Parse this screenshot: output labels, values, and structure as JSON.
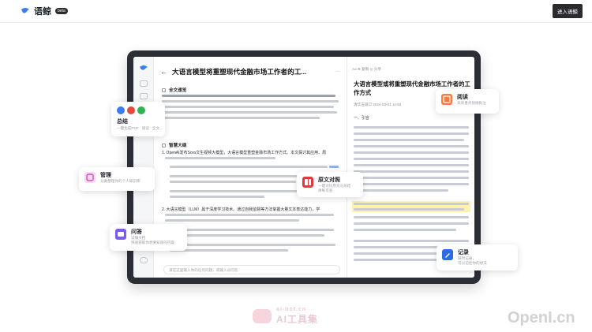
{
  "brand": {
    "name": "语鲸",
    "badge": "beta",
    "logo_color": "#3a7df0"
  },
  "header": {
    "enter_label": "进入语鲸"
  },
  "doc": {
    "title": "大语言模型将重塑现代金融市场工作者的工...",
    "section_full": "全文速览",
    "section_outline": "智慧大纲",
    "item1": "1. OpenAI发布Sora文生视频大模型，大语言模型重塑金融市场工作方式。本文探讨其应用、局",
    "item2": "2. 大语言模型（LLM）属于深度学习技术。通过自我监督等方法掌握大量文本表达能力，学",
    "ask_placeholder": "请在这里输入你的任何问题，或输入@问答"
  },
  "reader": {
    "toolbar": "Aa ⊕ 复制 ◎ 分享",
    "title": "大语言模型或将重塑现代金融市场工作者的工作方式",
    "meta": "清华五道口 2024-03-01 11:53",
    "para_head": "一、引言"
  },
  "cards": {
    "summary": {
      "title": "总结",
      "sub": "一键生成PDF · 速读 · 全文..."
    },
    "manage": {
      "title": "管理",
      "sub": "分类整理你的个人知识库"
    },
    "qa": {
      "title": "问答",
      "sub1": "读懂文档",
      "sub2": "快速获取你想要知道的内容"
    },
    "read": {
      "title": "阅读",
      "sub": "高亮重点划线批注"
    },
    "compare": {
      "title": "原文对照",
      "sub1": "一键对比原文与总结",
      "sub2": "清晰可查"
    },
    "note": {
      "title": "记录",
      "sub1": "随时记录，",
      "sub2": "可以记住你的想法"
    }
  },
  "watermark": {
    "cn_small": "ai-bot.cn",
    "cn_big": "AI工具集",
    "openl": "OpenI.cn"
  },
  "colors": {
    "summary_icons": [
      "#3a7df0",
      "#e8473e",
      "#2fb350"
    ],
    "manage": "#d64fb8",
    "qa": "#7a5bf0",
    "read": "#ff7a3d",
    "compare": "#e5383b",
    "note": "#2d6be6"
  }
}
